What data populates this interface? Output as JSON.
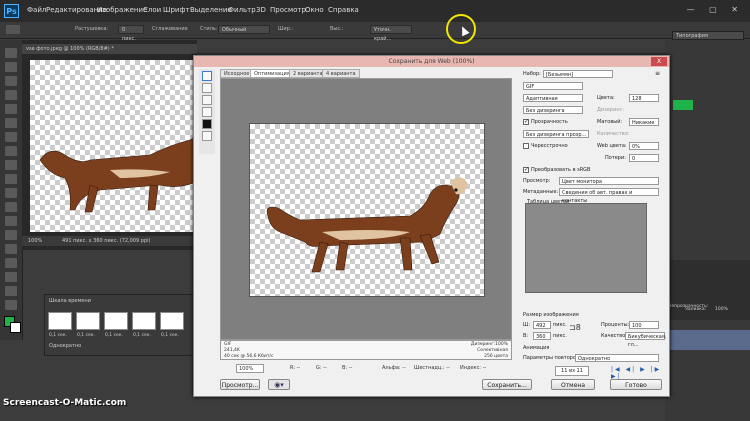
{
  "menubar": {
    "logo": "Ps",
    "items": [
      "Файл",
      "Редактирование",
      "Изображение",
      "Слои",
      "Шрифт",
      "Выделение",
      "Фильтр",
      "3D",
      "Просмотр",
      "Окно",
      "Справка"
    ]
  },
  "optionsbar": {
    "feather_label": "Растушевка:",
    "feather_value": "0 пикс.",
    "smoothing_label": "Сглаживание",
    "style_label": "Стиль:",
    "style_value": "Обычный",
    "width_label": "Шир.:",
    "height_label": "Выс.:",
    "refine_label": "Уточн. край...",
    "workspace": "Типография"
  },
  "document": {
    "tab_title": "vse фото.jpeg @ 100% (RGB/8#) *",
    "zoom": "100%",
    "status": "491 пикс. x 360 пикс. (72,009 ppi)"
  },
  "timeline": {
    "title": "Шкала времени",
    "frames": [
      {
        "time": "0,1 сек."
      },
      {
        "time": "0,1 сек."
      },
      {
        "time": "0,1 сек."
      },
      {
        "time": "0,1 сек."
      },
      {
        "time": "0,1 сек."
      }
    ],
    "loop": "Однократно"
  },
  "dialog": {
    "title": "Сохранить для Web (100%)",
    "close": "X",
    "tabs": [
      "Исходное",
      "Оптимизация",
      "2 варианта",
      "4 варианта"
    ],
    "info_left": [
      "GIF",
      "241,4K",
      "40 сек @ 56,6 Кбит/с"
    ],
    "info_right": [
      "Дизеринг:100%",
      "Селективная",
      "256 цвета"
    ],
    "bottom": {
      "zoom": "100%",
      "r": "R: --",
      "g": "G: --",
      "b": "B: --",
      "alpha": "Альфа: --",
      "hex": "Шестнадц.: --",
      "index": "Индекс: --"
    },
    "buttons": {
      "preview": "Просмотр...",
      "save": "Сохранить...",
      "cancel": "Отмена",
      "done": "Готово"
    },
    "settings": {
      "preset_label": "Набор:",
      "preset_value": "[Безымян]",
      "format": "GIF",
      "reduction": "Адаптивная",
      "colors_label": "Цвета:",
      "colors_value": "128",
      "dither": "Без дизеринга",
      "dither_amount_label": "Дизеринг:",
      "transparency_label": "Прозрачность",
      "matte_label": "Матовый:",
      "matte_value": "Никакие",
      "transp_dither": "Без дизеринга прозр...",
      "amount_label": "Количество:",
      "interlaced_label": "Чересстрочно",
      "websnap_label": "Web цвета:",
      "websnap_value": "0%",
      "lossy_label": "Потери:",
      "lossy_value": "0",
      "convert_srgb_label": "Преобразовать в sRGB",
      "preview_label": "Просмотр:",
      "preview_value": "Цвет монитора",
      "metadata_label": "Метаданные:",
      "metadata_value": "Сведения об авт. правах и контакты",
      "color_table_label": "Таблица цветов",
      "image_size_label": "Размер изображения",
      "w_label": "Ш:",
      "w_value": "492",
      "h_label": "В:",
      "h_value": "360",
      "unit": "пикс.",
      "percent_label": "Проценты:",
      "percent_value": "100",
      "quality_label": "Качество:",
      "quality_value": "Бикубическая, гл...",
      "animation_label": "Анимация",
      "loop_label": "Параметры повторов:",
      "loop_value": "Однократно",
      "frame_counter": "11 из 11"
    }
  },
  "right_panel": {
    "opacity_label": "Непрозрачность:",
    "fill_label": "Заливка:",
    "fill_value": "100%",
    "propagate_label": "Распространить кадр 1"
  },
  "watermark": "Screencast-O-Matic.com",
  "colors": {
    "dialog_title_bg": "#e8b7b2",
    "close_btn": "#c94b4b",
    "ps_blue": "#4db2ff",
    "fg_color": "#1fb34a"
  }
}
